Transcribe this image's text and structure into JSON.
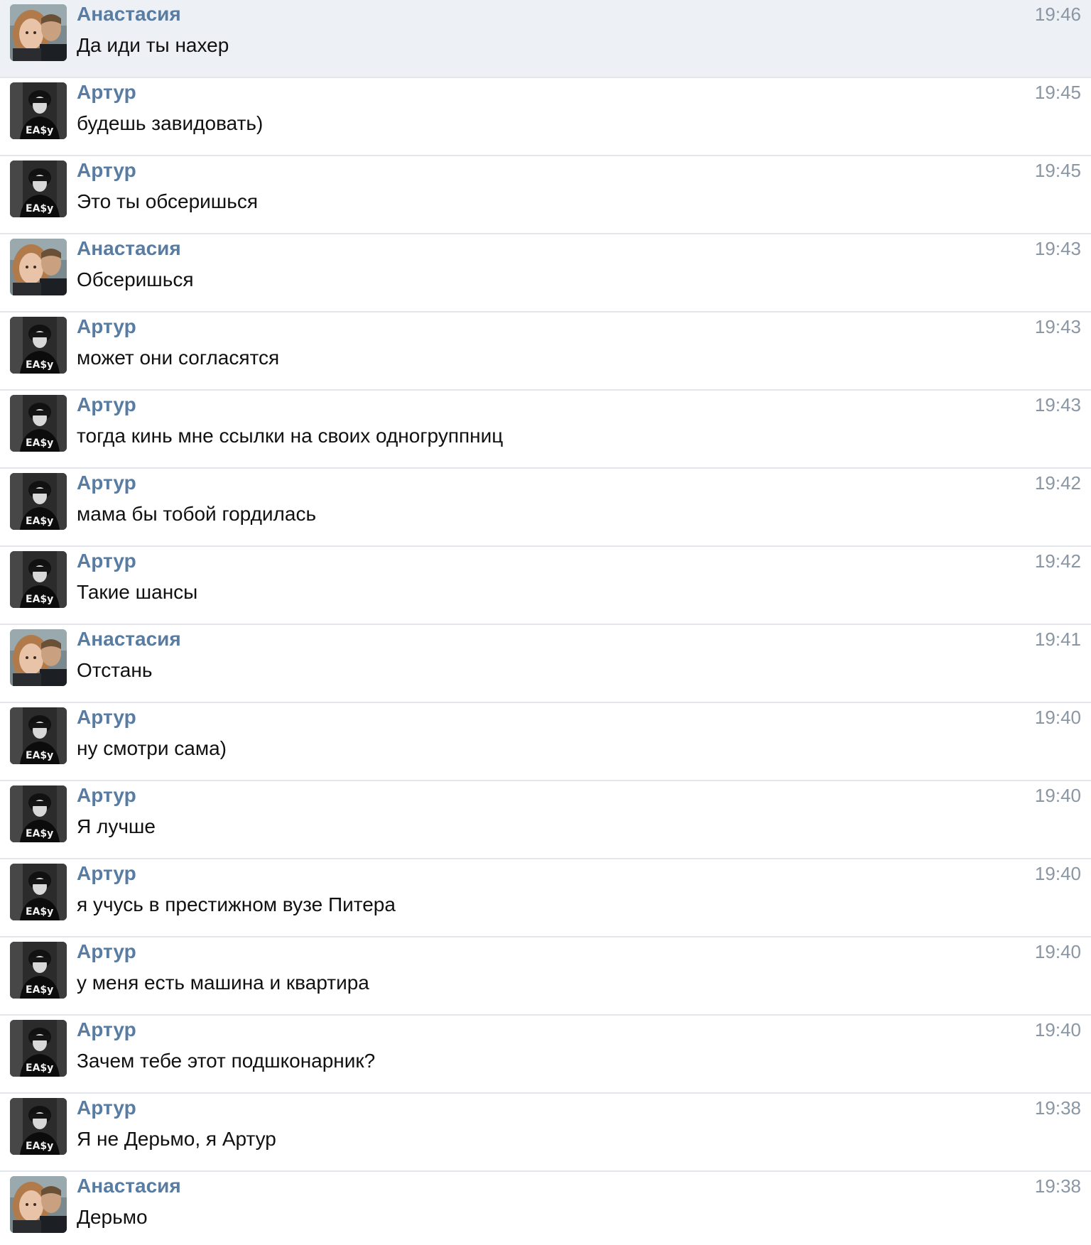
{
  "messages": [
    {
      "sender": "Анастасия",
      "text": "Да иди ты нахер",
      "time": "19:46",
      "avatar": "anastasia-avatar",
      "unread": true
    },
    {
      "sender": "Артур",
      "text": "будешь завидовать)",
      "time": "19:45",
      "avatar": "artur-avatar",
      "unread": false
    },
    {
      "sender": "Артур",
      "text": "Это ты обсеришься",
      "time": "19:45",
      "avatar": "artur-avatar",
      "unread": false
    },
    {
      "sender": "Анастасия",
      "text": "Обсеришься",
      "time": "19:43",
      "avatar": "anastasia-avatar",
      "unread": false
    },
    {
      "sender": "Артур",
      "text": "может они согласятся",
      "time": "19:43",
      "avatar": "artur-avatar",
      "unread": false
    },
    {
      "sender": "Артур",
      "text": "тогда кинь мне ссылки на своих одногруппниц",
      "time": "19:43",
      "avatar": "artur-avatar",
      "unread": false
    },
    {
      "sender": "Артур",
      "text": "мама бы тобой гордилась",
      "time": "19:42",
      "avatar": "artur-avatar",
      "unread": false
    },
    {
      "sender": "Артур",
      "text": "Такие шансы",
      "time": "19:42",
      "avatar": "artur-avatar",
      "unread": false
    },
    {
      "sender": "Анастасия",
      "text": "Отстань",
      "time": "19:41",
      "avatar": "anastasia-avatar",
      "unread": false
    },
    {
      "sender": "Артур",
      "text": "ну смотри сама)",
      "time": "19:40",
      "avatar": "artur-avatar",
      "unread": false
    },
    {
      "sender": "Артур",
      "text": "Я лучше",
      "time": "19:40",
      "avatar": "artur-avatar",
      "unread": false
    },
    {
      "sender": "Артур",
      "text": "я учусь в престижном вузе Питера",
      "time": "19:40",
      "avatar": "artur-avatar",
      "unread": false
    },
    {
      "sender": "Артур",
      "text": "у меня есть машина и квартира",
      "time": "19:40",
      "avatar": "artur-avatar",
      "unread": false
    },
    {
      "sender": "Артур",
      "text": "Зачем тебе этот подшконарник?",
      "time": "19:40",
      "avatar": "artur-avatar",
      "unread": false
    },
    {
      "sender": "Артур",
      "text": "Я не Дерьмо, я Артур",
      "time": "19:38",
      "avatar": "artur-avatar",
      "unread": false
    },
    {
      "sender": "Анастасия",
      "text": "Дерьмо",
      "time": "19:38",
      "avatar": "anastasia-avatar",
      "unread": false
    }
  ],
  "colors": {
    "sender_name": "#597ca2",
    "message_text": "#111111",
    "timestamp": "#8a96a3",
    "unread_background": "#edf0f5",
    "divider": "#e3e6ea"
  }
}
